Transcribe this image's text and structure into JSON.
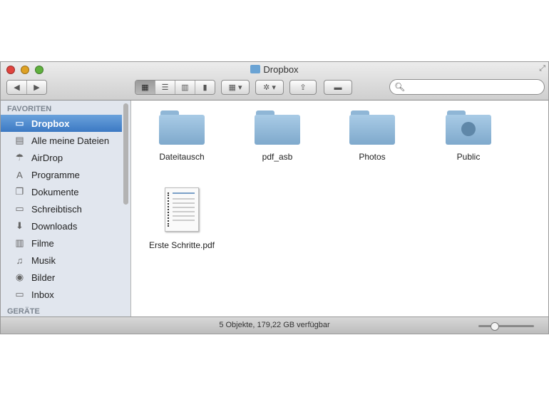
{
  "window": {
    "title": "Dropbox"
  },
  "toolbar": {
    "back": "◀",
    "forward": "▶",
    "view_modes": [
      "icon",
      "list",
      "columns",
      "coverflow"
    ],
    "arrange": "▦ ▾",
    "action": "✲ ▾",
    "share": "⇪",
    "label_toggle": "▬",
    "search_placeholder": ""
  },
  "sidebar": {
    "section_favorites": "FAVORITEN",
    "section_devices": "GERÄTE",
    "items": [
      {
        "label": "Dropbox",
        "icon": "folder-icon",
        "glyph": "▭"
      },
      {
        "label": "Alle meine Dateien",
        "icon": "all-files-icon",
        "glyph": "▤"
      },
      {
        "label": "AirDrop",
        "icon": "airdrop-icon",
        "glyph": "☂"
      },
      {
        "label": "Programme",
        "icon": "applications-icon",
        "glyph": "A"
      },
      {
        "label": "Dokumente",
        "icon": "documents-icon",
        "glyph": "❐"
      },
      {
        "label": "Schreibtisch",
        "icon": "desktop-icon",
        "glyph": "▭"
      },
      {
        "label": "Downloads",
        "icon": "downloads-icon",
        "glyph": "⬇"
      },
      {
        "label": "Filme",
        "icon": "movies-icon",
        "glyph": "▥"
      },
      {
        "label": "Musik",
        "icon": "music-icon",
        "glyph": "♫"
      },
      {
        "label": "Bilder",
        "icon": "pictures-icon",
        "glyph": "◉"
      },
      {
        "label": "Inbox",
        "icon": "folder-icon",
        "glyph": "▭"
      }
    ]
  },
  "files": [
    {
      "name": "Dateitausch"
    },
    {
      "name": "pdf_asb"
    },
    {
      "name": "Photos"
    },
    {
      "name": "Public"
    },
    {
      "name": "Erste Schritte.pdf"
    }
  ],
  "status": {
    "text": "5 Objekte, 179,22 GB verfügbar",
    "icon_size": 0.25
  }
}
